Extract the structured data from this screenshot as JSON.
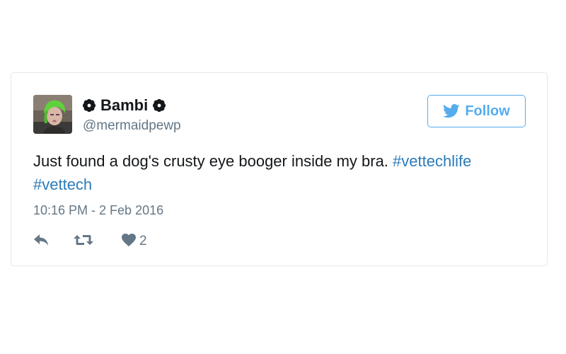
{
  "tweet": {
    "author": {
      "display_name": "Bambi",
      "handle": "@mermaidpewp",
      "badge_icon": "flower-badge-icon"
    },
    "follow_button": {
      "label": "Follow",
      "icon": "twitter-bird-icon"
    },
    "text": {
      "body": "Just found a dog's crusty eye booger inside my bra. ",
      "hashtags": [
        "#vettechlife",
        "#vettech"
      ]
    },
    "timestamp": "10:16 PM - 2 Feb 2016",
    "actions": {
      "reply_icon": "reply-icon",
      "retweet_icon": "retweet-icon",
      "like_icon": "heart-icon",
      "like_count": "2"
    }
  },
  "colors": {
    "accent": "#55acee",
    "hashtag": "#2b7bb9",
    "text": "#14171a",
    "muted": "#657786",
    "border": "#e1e8ed"
  }
}
